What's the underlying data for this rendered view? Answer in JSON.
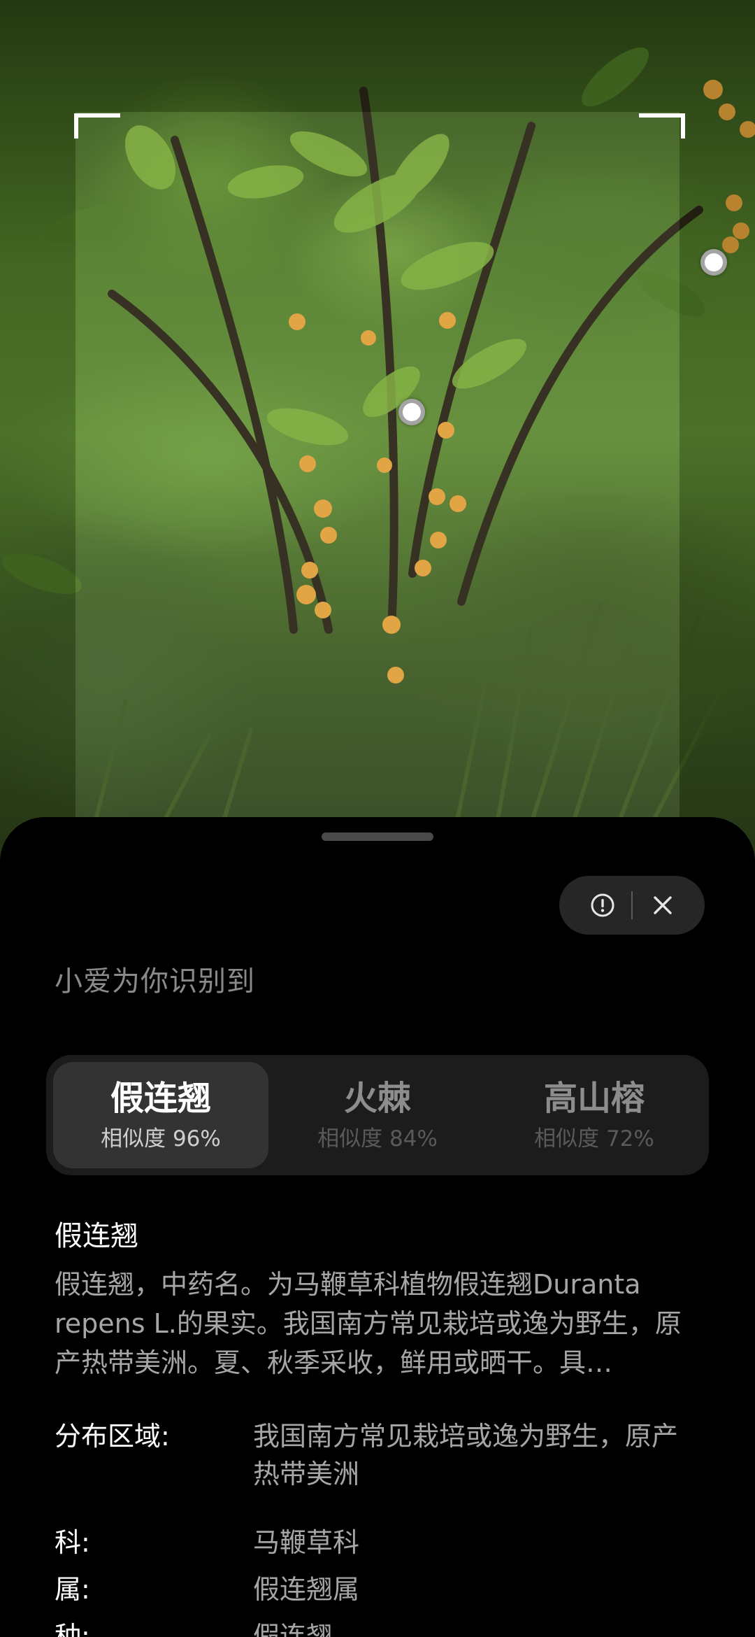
{
  "scanner": {
    "markers": [
      "selection-point",
      "selection-point"
    ]
  },
  "panel": {
    "heading": "小爱为你识别到",
    "actions": {
      "info_icon": "info-circle-icon",
      "close_icon": "close-icon"
    },
    "candidates": [
      {
        "name": "假连翘",
        "similarity": "相似度 96%",
        "selected": true
      },
      {
        "name": "火棘",
        "similarity": "相似度 84%",
        "selected": false
      },
      {
        "name": "高山榕",
        "similarity": "相似度 72%",
        "selected": false
      }
    ],
    "detail": {
      "title": "假连翘",
      "description": "假连翘，中药名。为马鞭草科植物假连翘Duranta repens L.的果实。我国南方常见栽培或逸为野生，原产热带美洲。夏、秋季采收，鲜用或晒干。具…",
      "info": [
        {
          "key": "分布区域:",
          "value": "我国南方常见栽培或逸为野生，原产热带美洲"
        },
        {
          "key": "科:",
          "value": "马鞭草科"
        },
        {
          "key": "属:",
          "value": "假连翘属"
        },
        {
          "key": "种:",
          "value": "假连翘"
        }
      ]
    }
  },
  "colors": {
    "sheet_bg": "#000000",
    "selected_card": "#333333",
    "card_group": "#1c1c1c",
    "text_primary": "#ffffff",
    "text_secondary": "#a6a6a6"
  }
}
